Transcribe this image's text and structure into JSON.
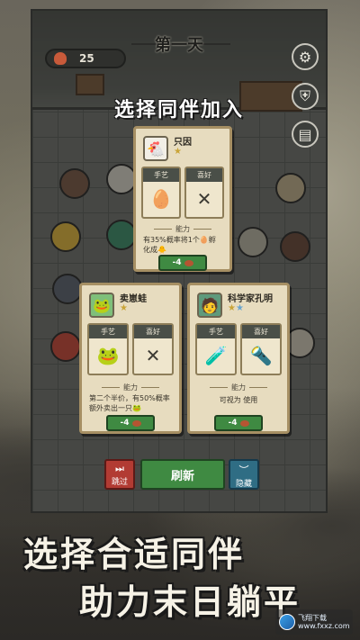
{
  "header": {
    "day_title": "第一天",
    "resource_value": "25"
  },
  "headline": "选择同伴加入",
  "cards": [
    {
      "name": "只因",
      "stars_gold": "★",
      "stars_blue": "",
      "skill_label": "手艺",
      "skill_icon": "🥚",
      "hobby_label": "喜好",
      "hobby_icon": "✕",
      "ability_label": "能力",
      "ability_text": "有35%概率将1个🥚孵化成🐥",
      "cost": "-4"
    },
    {
      "name": "卖崽蛙",
      "stars_gold": "★",
      "stars_blue": "",
      "skill_label": "手艺",
      "skill_icon": "🐸",
      "hobby_label": "喜好",
      "hobby_icon": "✕",
      "ability_label": "能力",
      "ability_text": "第二个半价，有50%概率额外卖出一只🐸",
      "cost": "-4"
    },
    {
      "name": "科学家孔明",
      "stars_gold": "★",
      "stars_blue": "★",
      "skill_label": "手艺",
      "skill_icon": "🧪",
      "hobby_label": "喜好",
      "hobby_icon": "🔦",
      "ability_label": "能力",
      "ability_text": "可视为 使用",
      "cost": "-4"
    }
  ],
  "buttons": {
    "skip": "跳过",
    "refresh": "刷新",
    "hide": "隐藏"
  },
  "promo": {
    "line1": "选择合适同伴",
    "line2": "助力末日躺平"
  },
  "logo": {
    "text1": "飞翔下载",
    "text2": "www.fxxz.com"
  }
}
